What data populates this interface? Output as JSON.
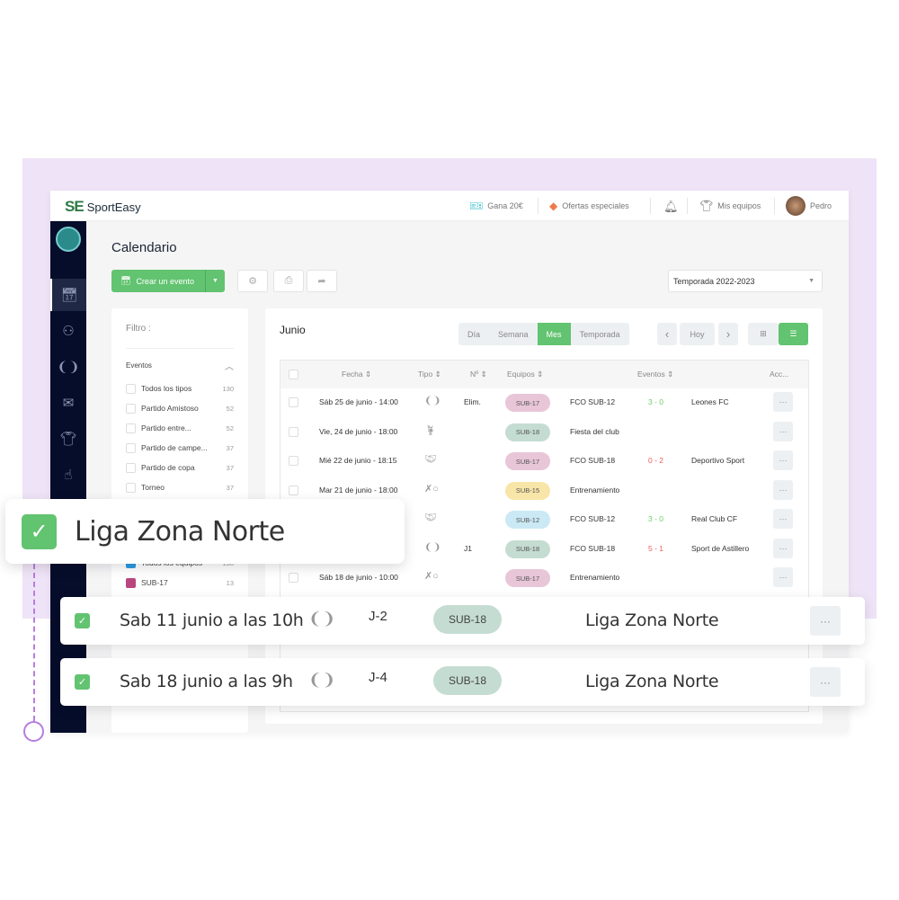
{
  "colors": {
    "accent": "#62c370",
    "sidebar": "#060d2b",
    "background_band": "#efe3f7",
    "timeline": "#b57ee0"
  },
  "app": {
    "logo_mark": "SE",
    "logo_text": "SportEasy"
  },
  "topbar": {
    "earn": "Gana 20€",
    "offers": "Ofertas especiales",
    "teams": "Mis equipos",
    "user": "Pedro"
  },
  "sidebar": {
    "items": [
      {
        "icon": "calendar-icon",
        "active": true
      },
      {
        "icon": "members-icon"
      },
      {
        "icon": "laurel-icon"
      },
      {
        "icon": "mail-icon"
      },
      {
        "icon": "shirt-icon"
      },
      {
        "icon": "hand-user-icon"
      }
    ]
  },
  "page": {
    "title": "Calendario",
    "create_label": "Crear un evento",
    "season": "Temporada 2022-2023"
  },
  "filter": {
    "title": "Filtro :",
    "section": "Eventos",
    "items": [
      {
        "label": "Todos los tipos",
        "count": "130"
      },
      {
        "label": "Partido Amistoso",
        "count": "52"
      },
      {
        "label": "Partido entre...",
        "count": "52"
      },
      {
        "label": "Partido de campe...",
        "count": "37"
      },
      {
        "label": "Partido de copa",
        "count": "37"
      },
      {
        "label": "Torneo",
        "count": "37"
      }
    ],
    "teams": [
      {
        "label": "Todos los equipos",
        "count": "130",
        "color": "#2b9be3"
      },
      {
        "label": "SUB-17",
        "count": "13",
        "color": "#b8467f"
      }
    ]
  },
  "calendar": {
    "month": "Junio",
    "views": [
      "Día",
      "Semana",
      "Mes",
      "Temporada"
    ],
    "active_view": "Mes",
    "today": "Hoy",
    "columns": [
      "Fecha",
      "Tipo",
      "Nº",
      "Equipos",
      "Eventos",
      "Acc..."
    ],
    "rows": [
      {
        "date": "Sáb 25 de junio - 14:00",
        "type": "cup",
        "num": "Elim.",
        "team": "SUB-17",
        "team_color": "#e8c6d8",
        "event": "FCO SUB-12",
        "score": "3 - 0",
        "score_color": "#6cd06c",
        "opponent": "Leones FC"
      },
      {
        "date": "Vie, 24 de junio - 18:00",
        "type": "party",
        "num": "",
        "team": "SUB-18",
        "team_color": "#c5dcd2",
        "event": "Fiesta del club",
        "score": "",
        "score_color": "",
        "opponent": ""
      },
      {
        "date": "Mié 22 de junio - 18:15",
        "type": "friendly",
        "num": "",
        "team": "SUB-17",
        "team_color": "#e8c6d8",
        "event": "FCO SUB-18",
        "score": "0 - 2",
        "score_color": "#f25a5a",
        "opponent": "Deportivo Sport"
      },
      {
        "date": "Mar 21 de junio - 18:00",
        "type": "training",
        "num": "",
        "team": "SUB-15",
        "team_color": "#f8e5a8",
        "event": "Entrenamiento",
        "score": "",
        "score_color": "",
        "opponent": ""
      },
      {
        "date": "",
        "type": "friendly",
        "num": "",
        "team": "SUB-12",
        "team_color": "#cbe9f4",
        "event": "FCO SUB-12",
        "score": "3 - 0",
        "score_color": "#6cd06c",
        "opponent": "Real Club CF"
      },
      {
        "date": "",
        "type": "cup",
        "num": "J1",
        "team": "SUB-18",
        "team_color": "#c5dcd2",
        "event": "FCO SUB-18",
        "score": "5 - 1",
        "score_color": "#f25a5a",
        "opponent": "Sport de Astillero"
      },
      {
        "date": "Sáb 18 de junio - 10:00",
        "type": "training",
        "num": "",
        "team": "SUB-17",
        "team_color": "#e8c6d8",
        "event": "Entrenamiento",
        "score": "",
        "score_color": "",
        "opponent": ""
      }
    ]
  },
  "highlight": {
    "label": "Liga Zona Norte",
    "checked": true
  },
  "highlight_rows": [
    {
      "date": "Sab 11 junio a las 10h",
      "num": "J-2",
      "team": "SUB-18",
      "competition": "Liga Zona Norte",
      "checked": true
    },
    {
      "date": "Sab 18 junio a las 9h",
      "num": "J-4",
      "team": "SUB-18",
      "competition": "Liga Zona Norte",
      "checked": true
    }
  ]
}
